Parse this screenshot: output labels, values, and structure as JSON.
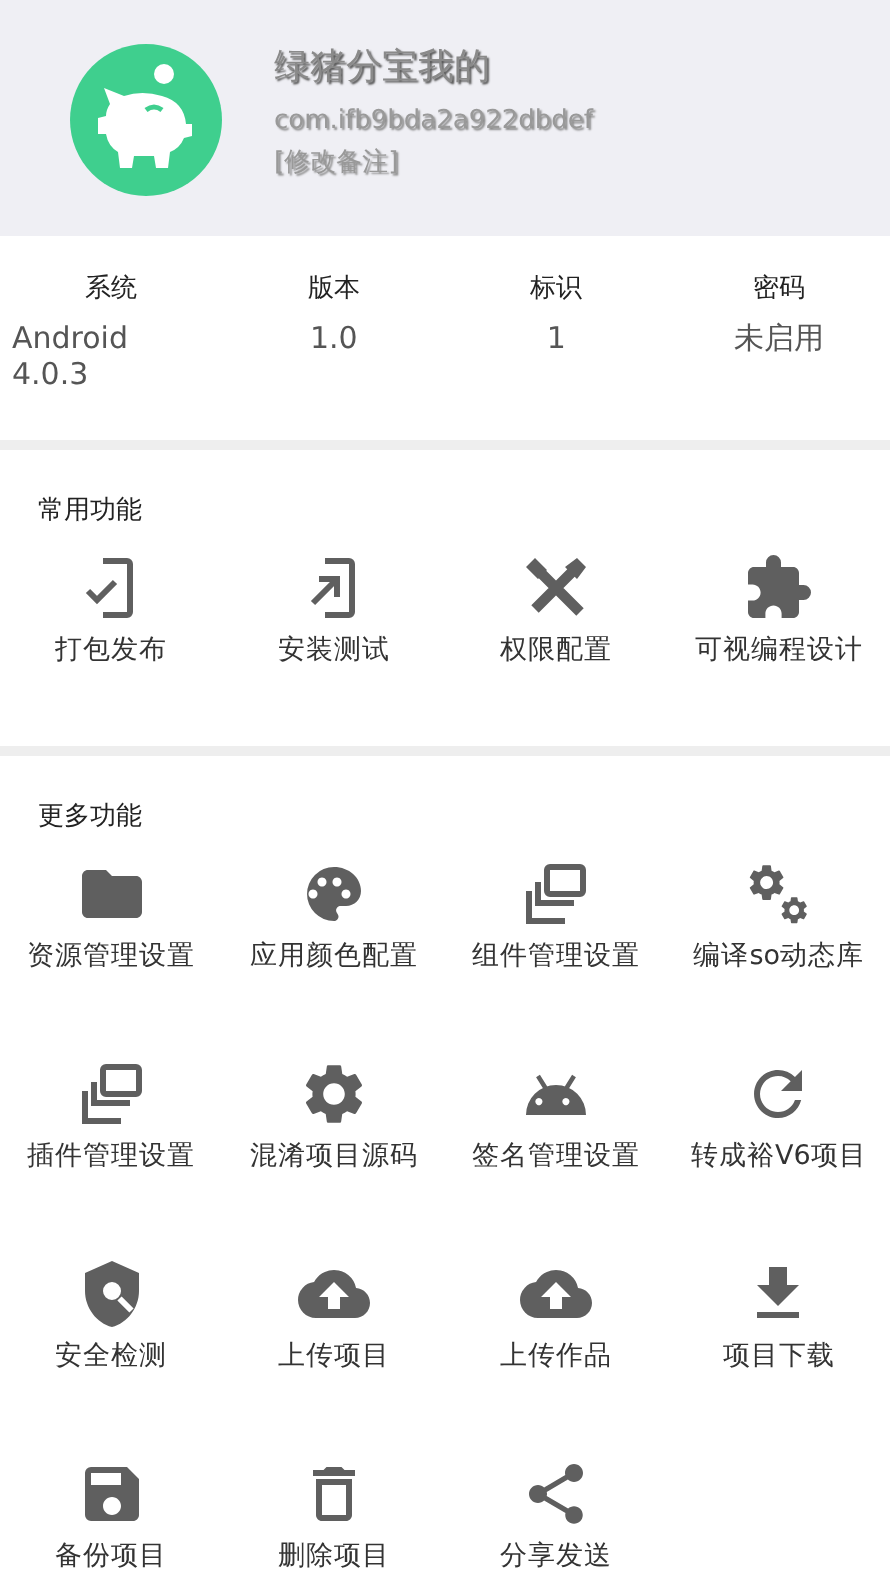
{
  "header": {
    "title": "绿猪分宝我的",
    "package": "com.ifb9bda2a922dbdef",
    "edit_note": "[修改备注]"
  },
  "info": [
    {
      "label": "系统",
      "value": "Android 4.0.3"
    },
    {
      "label": "版本",
      "value": "1.0"
    },
    {
      "label": "标识",
      "value": "1"
    },
    {
      "label": "密码",
      "value": "未启用"
    }
  ],
  "sections": [
    {
      "title": "常用功能",
      "items": [
        "打包发布",
        "安装测试",
        "权限配置",
        "可视编程设计"
      ]
    },
    {
      "title": "更多功能",
      "items": [
        "资源管理设置",
        "应用颜色配置",
        "组件管理设置",
        "编译so动态库",
        "插件管理设置",
        "混淆项目源码",
        "签名管理设置",
        "转成裕V6项目",
        "安全检测",
        "上传项目",
        "上传作品",
        "项目下载",
        "备份项目",
        "删除项目",
        "分享发送"
      ]
    }
  ]
}
